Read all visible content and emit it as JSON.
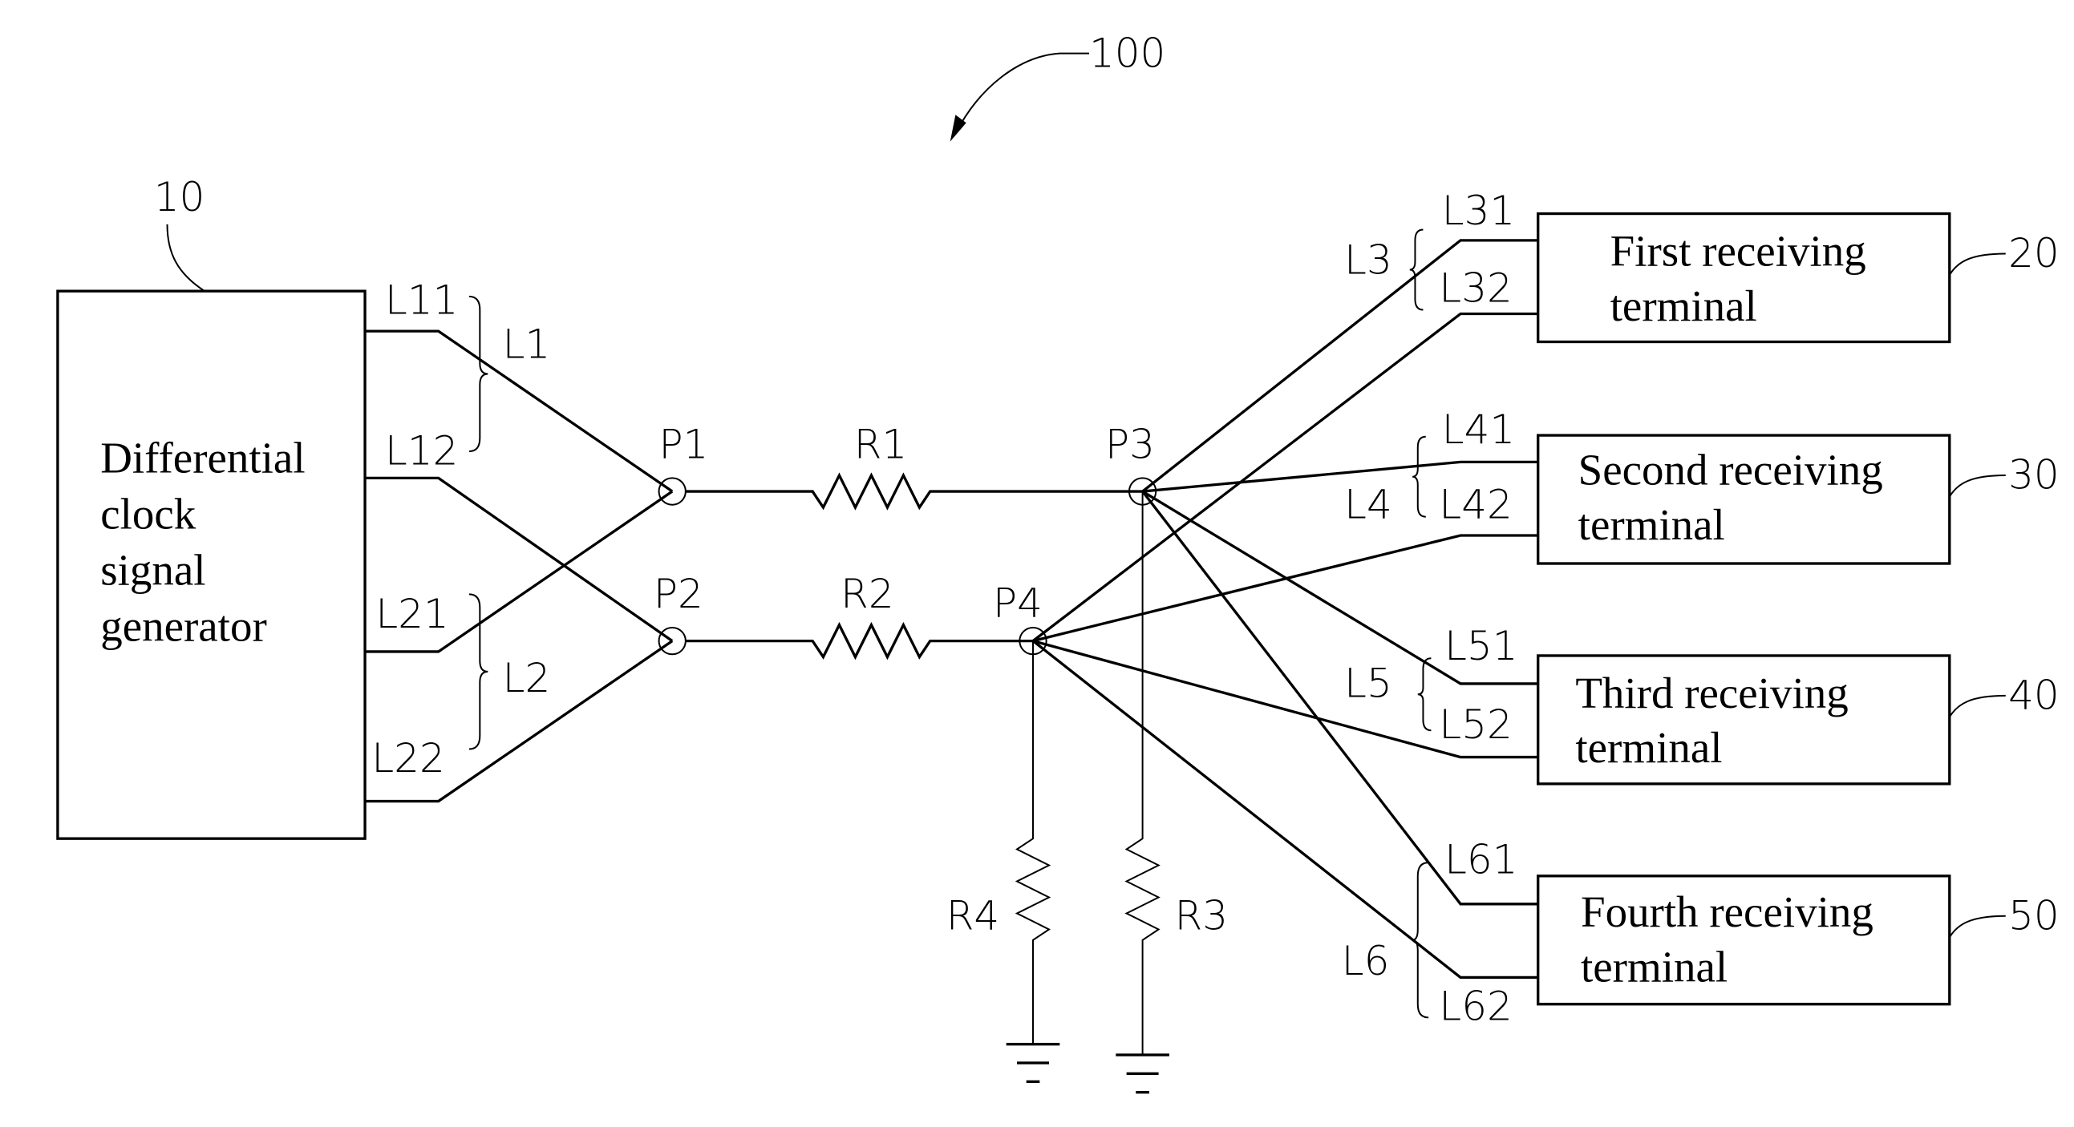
{
  "figure": {
    "reference": "100",
    "generator": {
      "ref": "10",
      "lines": [
        "Differential",
        "clock",
        "signal",
        "generator"
      ]
    },
    "receivers": [
      {
        "ref": "20",
        "lines": [
          "First receiving",
          "terminal"
        ],
        "pair": "L3",
        "pos": "L31",
        "neg": "L32"
      },
      {
        "ref": "30",
        "lines": [
          "Second receiving",
          "terminal"
        ],
        "pair": "L4",
        "pos": "L41",
        "neg": "L42"
      },
      {
        "ref": "40",
        "lines": [
          "Third receiving",
          "terminal"
        ],
        "pair": "L5",
        "pos": "L51",
        "neg": "L52"
      },
      {
        "ref": "50",
        "lines": [
          "Fourth receiving",
          "terminal"
        ],
        "pair": "L6",
        "pos": "L61",
        "neg": "L62"
      }
    ],
    "input_pairs": [
      {
        "pair": "L1",
        "a": "L11",
        "b": "L12"
      },
      {
        "pair": "L2",
        "a": "L21",
        "b": "L22"
      }
    ],
    "nodes": [
      "P1",
      "P2",
      "P3",
      "P4"
    ],
    "resistors": [
      "R1",
      "R2",
      "R3",
      "R4"
    ]
  }
}
